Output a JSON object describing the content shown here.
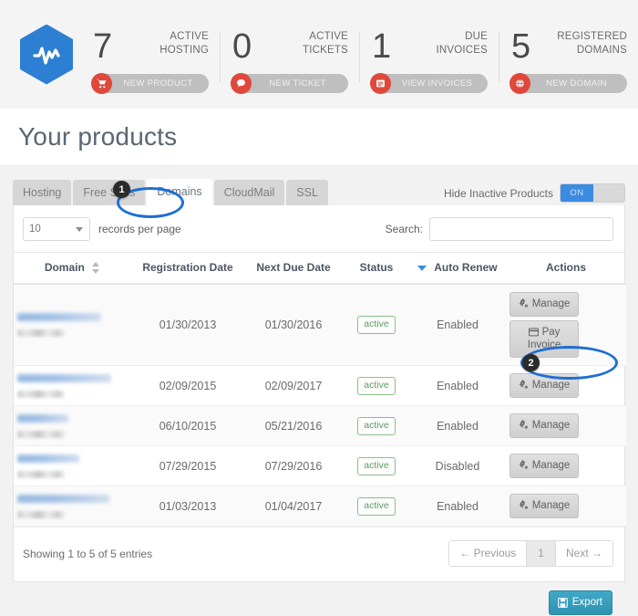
{
  "brand": {
    "logo_icon": "hexagon-pulse-logo",
    "logo_color": "#2d7fd3"
  },
  "stats": [
    {
      "number": "7",
      "label_line1": "ACTIVE",
      "label_line2": "HOSTING",
      "button_label": "NEW PRODUCT",
      "button_icon": "cart-icon"
    },
    {
      "number": "0",
      "label_line1": "ACTIVE",
      "label_line2": "TICKETS",
      "button_label": "NEW TICKET",
      "button_icon": "chat-bubble-icon"
    },
    {
      "number": "1",
      "label_line1": "DUE",
      "label_line2": "INVOICES",
      "button_label": "VIEW INVOICES",
      "button_icon": "invoice-list-icon"
    },
    {
      "number": "5",
      "label_line1": "REGISTERED",
      "label_line2": "DOMAINS",
      "button_label": "NEW DOMAIN",
      "button_icon": "globe-icon"
    }
  ],
  "page": {
    "title": "Your products"
  },
  "tabs": [
    {
      "label": "Hosting",
      "active": false
    },
    {
      "label": "Free Sites",
      "active": false
    },
    {
      "label": "Domains",
      "active": true
    },
    {
      "label": "CloudMail",
      "active": false
    },
    {
      "label": "SSL",
      "active": false
    }
  ],
  "hide_inactive": {
    "label": "Hide Inactive Products",
    "state": "ON"
  },
  "toolbar": {
    "records_value": "10",
    "records_label": "records per page",
    "search_label": "Search:",
    "search_value": "",
    "search_placeholder": ""
  },
  "table": {
    "columns": [
      "Domain",
      "Registration Date",
      "Next Due Date",
      "Status",
      "Auto Renew",
      "Actions"
    ],
    "rows": [
      {
        "domain": "",
        "registration_date": "01/30/2013",
        "next_due_date": "01/30/2016",
        "status": "active",
        "auto_renew": "Enabled",
        "actions": [
          "Manage",
          "Pay Invoice"
        ]
      },
      {
        "domain": "",
        "registration_date": "02/09/2015",
        "next_due_date": "02/09/2017",
        "status": "active",
        "auto_renew": "Enabled",
        "actions": [
          "Manage"
        ]
      },
      {
        "domain": "",
        "registration_date": "06/10/2015",
        "next_due_date": "05/21/2016",
        "status": "active",
        "auto_renew": "Enabled",
        "actions": [
          "Manage"
        ]
      },
      {
        "domain": "",
        "registration_date": "07/29/2015",
        "next_due_date": "07/29/2016",
        "status": "active",
        "auto_renew": "Disabled",
        "actions": [
          "Manage"
        ]
      },
      {
        "domain": "",
        "registration_date": "01/03/2013",
        "next_due_date": "01/04/2017",
        "status": "active",
        "auto_renew": "Enabled",
        "actions": [
          "Manage"
        ]
      }
    ]
  },
  "footer": {
    "entries": "Showing 1 to 5 of 5 entries",
    "pager": {
      "previous": "← Previous",
      "current": "1",
      "next": "Next →"
    }
  },
  "export": {
    "label": "Export",
    "icon": "save-disk-icon",
    "color": "#2f93b4"
  },
  "annotations": [
    {
      "number": "1",
      "target": "tab-domains"
    },
    {
      "number": "2",
      "target": "row-2-manage-button"
    }
  ],
  "colors": {
    "accent_blue": "#3b8be0",
    "annotation_blue": "#1f6fd0",
    "status_green": "#5d9c5d",
    "stat_icon_red": "#e0483c"
  }
}
